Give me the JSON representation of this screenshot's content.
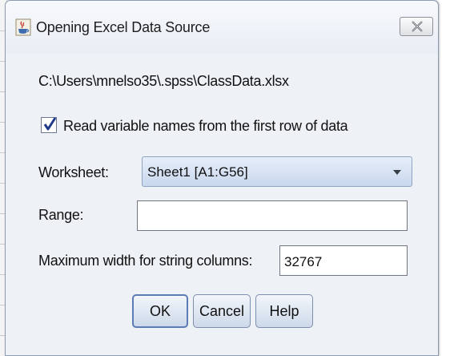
{
  "dialog": {
    "title": "Opening Excel Data Source",
    "file_path": "C:\\Users\\mnelso35\\.spss\\ClassData.xlsx",
    "read_names": {
      "label": "Read variable names from the first row of data",
      "checked": true
    },
    "worksheet": {
      "label": "Worksheet:",
      "value": "Sheet1 [A1:G56]"
    },
    "range": {
      "label": "Range:",
      "value": ""
    },
    "max_width": {
      "label": "Maximum width for string columns:",
      "value": "32767"
    },
    "buttons": {
      "ok": "OK",
      "cancel": "Cancel",
      "help": "Help"
    }
  },
  "colors": {
    "dialog_bg": "#eef1f6",
    "button_gradient_bottom": "#cdd9ea",
    "select_gradient_bottom": "#c9d8ee",
    "check_mark": "#1f3a8a"
  },
  "icons": {
    "app": "java-coffee-cup-icon",
    "close": "close-x-icon",
    "checkbox": "check-mark-icon",
    "dropdown": "triangle-down-icon"
  }
}
